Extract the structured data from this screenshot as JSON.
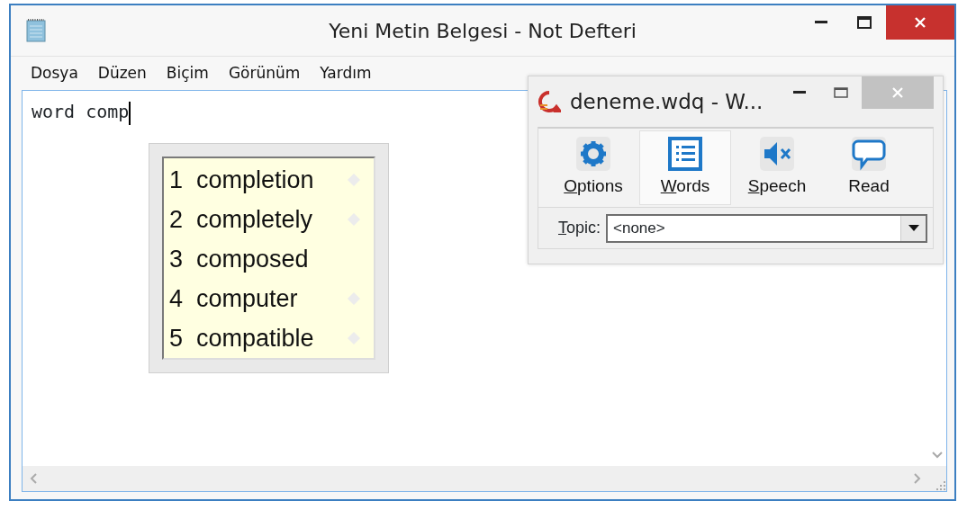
{
  "window": {
    "title": "Yeni Metin Belgesi - Not Defteri"
  },
  "menu": [
    "Dosya",
    "Düzen",
    "Biçim",
    "Görünüm",
    "Yardım"
  ],
  "editor": {
    "text": "word comp"
  },
  "suggestions": [
    {
      "number": "1",
      "word": "completion",
      "marked": true
    },
    {
      "number": "2",
      "word": "completely",
      "marked": true
    },
    {
      "number": "3",
      "word": "composed",
      "marked": false
    },
    {
      "number": "4",
      "word": "computer",
      "marked": true
    },
    {
      "number": "5",
      "word": "compatible",
      "marked": true
    }
  ],
  "tool_window": {
    "title": "deneme.wdq - W...",
    "buttons": [
      {
        "kind": "gear",
        "label": "Options",
        "selected": false,
        "underline_first": true
      },
      {
        "kind": "list",
        "label": "Words",
        "selected": true,
        "underline_first": true
      },
      {
        "kind": "mute",
        "label": "Speech",
        "selected": false,
        "underline_first": true
      },
      {
        "kind": "bubble",
        "label": "Read",
        "selected": false,
        "underline_first": false
      }
    ],
    "topic": {
      "label": "Topic:",
      "value": "<none>"
    }
  }
}
